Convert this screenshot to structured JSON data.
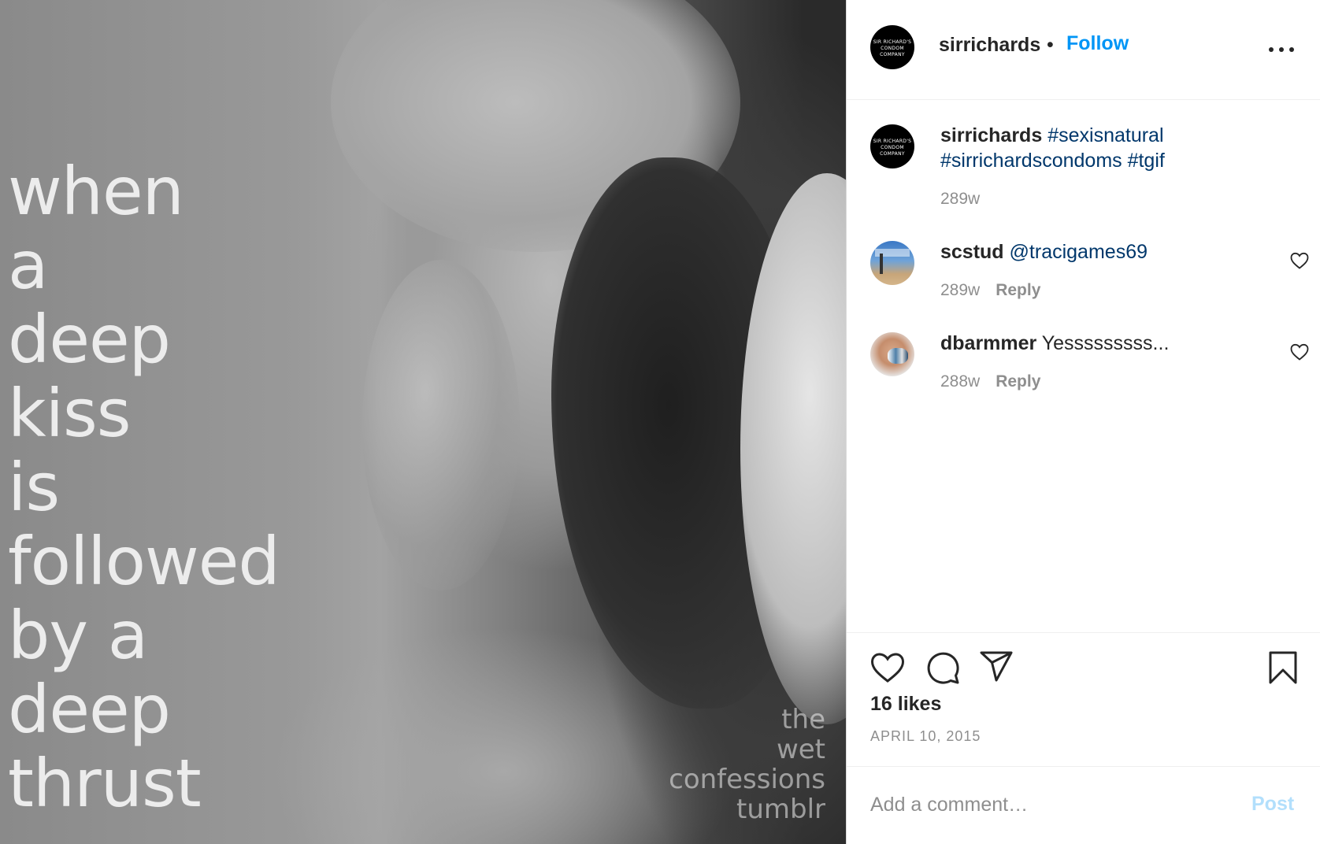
{
  "image": {
    "poem_lines": [
      "when",
      "a",
      "deep",
      "kiss",
      "is",
      "followed",
      "by a",
      "deep",
      "thrust"
    ],
    "watermark_lines": [
      "the",
      "wet",
      "confessions",
      "tumblr"
    ]
  },
  "header": {
    "username": "sirrichards",
    "separator": "•",
    "follow_label": "Follow",
    "avatar_logo_text": "SIR RICHARD'S CONDOM COMPANY"
  },
  "caption": {
    "username": "sirrichards",
    "hashtags": "#sexisnatural #sirrichardscondoms #tgif",
    "age": "289w"
  },
  "comments": [
    {
      "username": "scstud",
      "text": "@tracigames69",
      "age": "289w",
      "reply_label": "Reply"
    },
    {
      "username": "dbarmmer",
      "text": "Yesssssssss...",
      "age": "288w",
      "reply_label": "Reply"
    }
  ],
  "actions": {
    "likes": "16 likes",
    "date": "APRIL 10, 2015"
  },
  "composer": {
    "placeholder": "Add a comment…",
    "post_label": "Post"
  },
  "icons": [
    "more-options-icon",
    "heart-icon",
    "comment-icon",
    "share-icon",
    "bookmark-icon"
  ],
  "colors": {
    "follow": "#0095f6",
    "hashtag": "#00376b",
    "muted": "#8e8e8e",
    "post_disabled": "#b2dffc"
  }
}
